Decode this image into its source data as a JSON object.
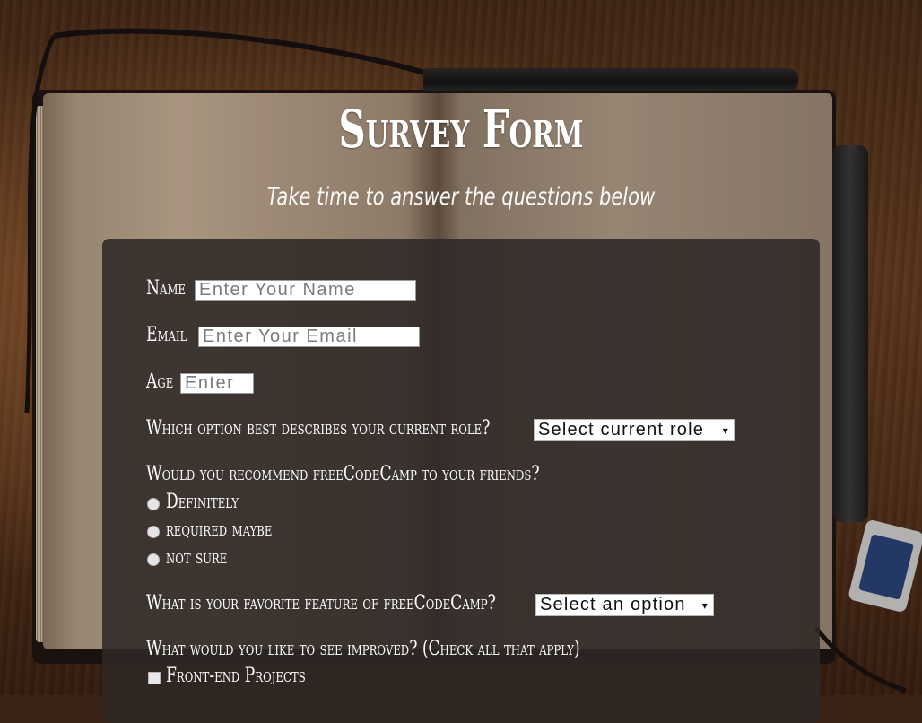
{
  "header": {
    "title": "Survey Form",
    "subtitle": "Take time to answer the questions below"
  },
  "form": {
    "name": {
      "label": "Name",
      "placeholder": "Enter Your Name"
    },
    "email": {
      "label": "Email",
      "placeholder": "Enter Your Email"
    },
    "age": {
      "label": "Age",
      "placeholder": "Enter"
    },
    "role": {
      "label": "Which option best describes your current role?",
      "selected": "Select current role"
    },
    "recommend": {
      "label": "Would you recommend freeCodeCamp to your friends?",
      "options": [
        "Definitely",
        "required maybe",
        "not sure"
      ]
    },
    "feature": {
      "label": "What is your favorite feature of freeCodeCamp?",
      "selected": "Select an option"
    },
    "improve": {
      "label": "What would you like to see improved? (Check all that apply)",
      "options": [
        "Front-end Projects"
      ]
    }
  },
  "icons": {
    "select_arrow": "▾"
  }
}
